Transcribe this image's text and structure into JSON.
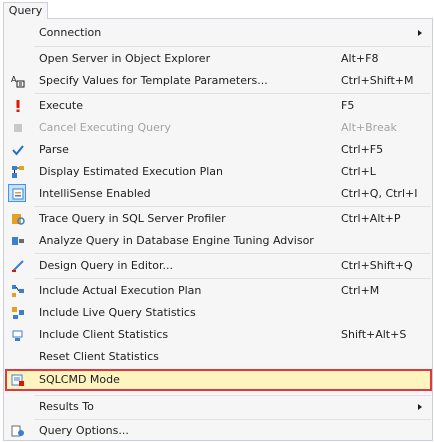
{
  "menubar": {
    "tab_label": "Query"
  },
  "menu": {
    "items": [
      {
        "label": "Connection",
        "shortcut": "",
        "icon": "none",
        "submenu": true
      },
      {
        "label": "Open Server in Object Explorer",
        "shortcut": "Alt+F8",
        "icon": "none"
      },
      {
        "label": "Specify Values for Template Parameters...",
        "shortcut": "Ctrl+Shift+M",
        "icon": "template-params-icon"
      },
      {
        "label": "Execute",
        "shortcut": "F5",
        "icon": "execute-icon"
      },
      {
        "label": "Cancel Executing Query",
        "shortcut": "Alt+Break",
        "icon": "cancel-icon",
        "disabled": true
      },
      {
        "label": "Parse",
        "shortcut": "Ctrl+F5",
        "icon": "checkmark-icon"
      },
      {
        "label": "Display Estimated Execution Plan",
        "shortcut": "Ctrl+L",
        "icon": "execution-plan-icon"
      },
      {
        "label": "IntelliSense Enabled",
        "shortcut": "Ctrl+Q, Ctrl+I",
        "icon": "intellisense-icon",
        "checked": true
      },
      {
        "label": "Trace Query in SQL Server Profiler",
        "shortcut": "Ctrl+Alt+P",
        "icon": "profiler-icon"
      },
      {
        "label": "Analyze Query in Database Engine Tuning Advisor",
        "shortcut": "",
        "icon": "tuning-advisor-icon"
      },
      {
        "label": "Design Query in Editor...",
        "shortcut": "Ctrl+Shift+Q",
        "icon": "design-query-icon"
      },
      {
        "label": "Include Actual Execution Plan",
        "shortcut": "Ctrl+M",
        "icon": "actual-plan-icon"
      },
      {
        "label": "Include Live Query Statistics",
        "shortcut": "",
        "icon": "live-stats-icon"
      },
      {
        "label": "Include Client Statistics",
        "shortcut": "Shift+Alt+S",
        "icon": "client-stats-icon"
      },
      {
        "label": "Reset Client Statistics",
        "shortcut": "",
        "icon": "none"
      },
      {
        "label": "SQLCMD Mode",
        "shortcut": "",
        "icon": "sqlcmd-icon",
        "highlighted": true
      },
      {
        "label": "Results To",
        "shortcut": "",
        "icon": "none",
        "submenu": true
      },
      {
        "label": "Query Options...",
        "shortcut": "",
        "icon": "query-options-icon"
      }
    ]
  },
  "colors": {
    "highlight_background": "#fdf4bf",
    "highlight_border": "#e0383e",
    "disabled_text": "#a2a4a5"
  }
}
